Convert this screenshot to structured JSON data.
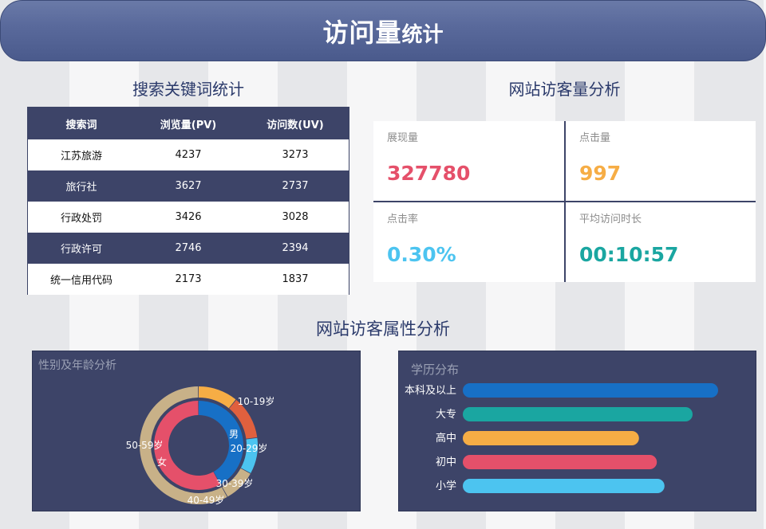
{
  "header": {
    "title_main": "访问量",
    "title_sub": "统计"
  },
  "keywords": {
    "title": "搜索关键词统计",
    "columns": [
      "搜索词",
      "浏览量(PV)",
      "访问数(UV)"
    ],
    "rows": [
      [
        "江苏旅游",
        "4237",
        "3273"
      ],
      [
        "旅行社",
        "3627",
        "2737"
      ],
      [
        "行政处罚",
        "3426",
        "3028"
      ],
      [
        "行政许可",
        "2746",
        "2394"
      ],
      [
        "统一信用代码",
        "2173",
        "1837"
      ]
    ]
  },
  "visitors": {
    "title": "网站访客量分析",
    "cells": [
      {
        "label": "展现量",
        "value": "327780",
        "color": "#e5506a"
      },
      {
        "label": "点击量",
        "value": "997",
        "color": "#f6ad45"
      },
      {
        "label": "点击率",
        "value": "0.30%",
        "color": "#4cc4f0"
      },
      {
        "label": "平均访问时长",
        "value": "00:10:57",
        "color": "#1aa6a1"
      }
    ]
  },
  "attributes": {
    "title": "网站访客属性分析"
  },
  "gender_age": {
    "title": "性别及年龄分析",
    "chart_data": {
      "type": "pie",
      "inner": {
        "categories": [
          "男",
          "女"
        ],
        "values": [
          42,
          58
        ],
        "colors": [
          "#1770c6",
          "#e5506a"
        ]
      },
      "outer": {
        "categories": [
          "10-19岁",
          "20-29岁",
          "30-39岁",
          "40-49岁",
          "50-59岁"
        ],
        "values": [
          11,
          12,
          10,
          9,
          58
        ],
        "colors": [
          "#f6ad45",
          "#e0603e",
          "#4cc4f0",
          "#c8b188",
          "#c8b188"
        ]
      }
    }
  },
  "education": {
    "title": "学历分布",
    "chart_data": {
      "type": "bar",
      "categories": [
        "本科及以上",
        "大专",
        "高中",
        "初中",
        "小学"
      ],
      "values": [
        100,
        90,
        69,
        76,
        79
      ],
      "colors": [
        "#1770c6",
        "#1aa6a1",
        "#f6ad45",
        "#e5506a",
        "#4cc4f0"
      ]
    }
  }
}
